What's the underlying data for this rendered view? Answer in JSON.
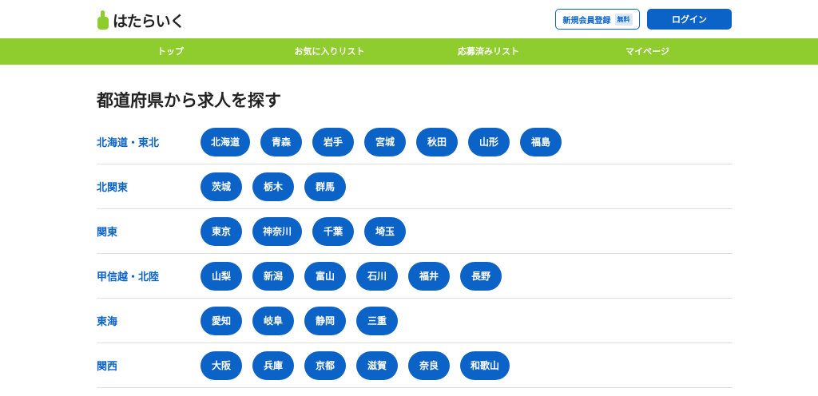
{
  "header": {
    "logo_text": "はたらいく",
    "register_label": "新規会員登録",
    "register_badge": "無料",
    "login_label": "ログイン"
  },
  "nav": {
    "items": [
      "トップ",
      "お気に入りリスト",
      "応募済みリスト",
      "マイページ"
    ]
  },
  "main": {
    "title": "都道府県から求人を探す",
    "regions": [
      {
        "name": "北海道・東北",
        "prefs": [
          "北海道",
          "青森",
          "岩手",
          "宮城",
          "秋田",
          "山形",
          "福島"
        ]
      },
      {
        "name": "北関東",
        "prefs": [
          "茨城",
          "栃木",
          "群馬"
        ]
      },
      {
        "name": "関東",
        "prefs": [
          "東京",
          "神奈川",
          "千葉",
          "埼玉"
        ]
      },
      {
        "name": "甲信越・北陸",
        "prefs": [
          "山梨",
          "新潟",
          "富山",
          "石川",
          "福井",
          "長野"
        ]
      },
      {
        "name": "東海",
        "prefs": [
          "愛知",
          "岐阜",
          "静岡",
          "三重"
        ]
      },
      {
        "name": "関西",
        "prefs": [
          "大阪",
          "兵庫",
          "京都",
          "滋賀",
          "奈良",
          "和歌山"
        ]
      }
    ]
  },
  "colors": {
    "accent_blue": "#0b63c8",
    "nav_green": "#8fcc2e"
  }
}
